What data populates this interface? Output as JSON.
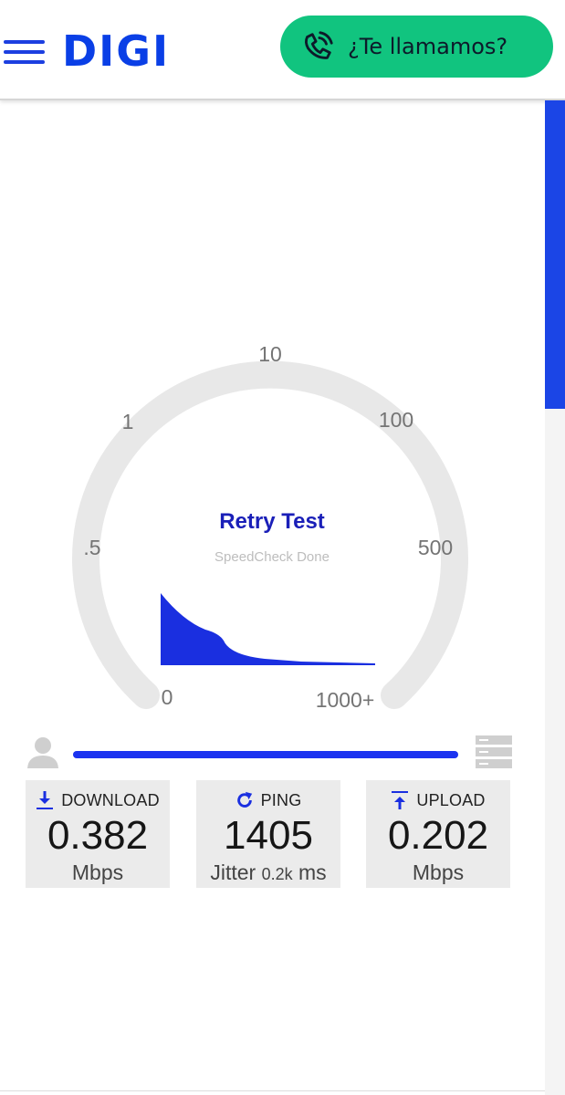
{
  "header": {
    "logo_text": "DIGI",
    "call_button_label": "¿Te llamamos?",
    "colors": {
      "brand_blue": "#0a3fe6",
      "call_green": "#11c47f"
    }
  },
  "gauge": {
    "tick_labels": [
      "0",
      ".5",
      "1",
      "10",
      "100",
      "500",
      "1000+"
    ],
    "retry_label": "Retry Test",
    "status_text": "SpeedCheck Done",
    "progress_fraction": 1.0
  },
  "results": {
    "download": {
      "label": "DOWNLOAD",
      "value": "0.382",
      "unit": "Mbps",
      "icon": "download-arrow-icon"
    },
    "ping": {
      "label": "PING",
      "value": "1405",
      "jitter_label": "Jitter",
      "jitter_value": "0.2k",
      "jitter_unit": "ms",
      "icon": "refresh-icon"
    },
    "upload": {
      "label": "UPLOAD",
      "value": "0.202",
      "unit": "Mbps",
      "icon": "upload-arrow-icon"
    }
  }
}
